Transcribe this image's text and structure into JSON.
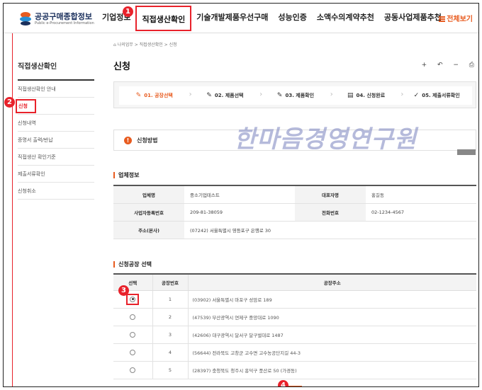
{
  "header": {
    "logo_title": "공공구매종합정보",
    "logo_sub": "Public e-Procurement Information",
    "nav": [
      "기업정보",
      "직접생산확인",
      "기술개발제품우선구매",
      "성능인증",
      "소액수의계약추천",
      "공동사업제품추천"
    ],
    "all_menu": "전체보기"
  },
  "sidebar": {
    "title": "직접생산확인",
    "items": [
      "직접생산확인 안내",
      "신청",
      "신청내역",
      "증명서 출력/반납",
      "직접생산 확인기준",
      "제출서류확인",
      "신청취소"
    ]
  },
  "main": {
    "breadcrumb": "나의업무 > 직접생산확인 > 신청",
    "title": "신청",
    "tools": "+ ↶ − ⎙",
    "steps": [
      {
        "label": "01. 공장선택",
        "icon": "✎"
      },
      {
        "label": "02. 제품선택",
        "icon": "✎"
      },
      {
        "label": "03. 제품확인",
        "icon": "✎"
      },
      {
        "label": "04. 신청완료",
        "icon": "▤"
      },
      {
        "label": "05. 제출서류확인",
        "icon": "✓"
      }
    ],
    "method": "신청방법",
    "watermark": "한마음경영연구원",
    "company_section": "업체정보",
    "company": {
      "name_label": "업체명",
      "name": "중소기업테스트",
      "ceo_label": "대표자명",
      "ceo": "홍길동",
      "bizno_label": "사업자등록번호",
      "bizno": "209-81-38059",
      "tel_label": "전화번호",
      "tel": "02-1234-4567",
      "addr_label": "주소(본사)",
      "addr": "(07242) 서울특별시 영등포구 은행로 30"
    },
    "factory_section": "신청공장 선택",
    "factory_headers": [
      "선택",
      "공장번호",
      "공장주소"
    ],
    "factories": [
      {
        "no": "1",
        "addr": "(03902) 서울특별시 마포구 성암로 189"
      },
      {
        "no": "2",
        "addr": "(47539) 부산광역시 연제구 중앙대로 1090"
      },
      {
        "no": "3",
        "addr": "(42606) 대구광역시 달서구 달구벌대로 1487"
      },
      {
        "no": "4",
        "addr": "(56644) 전라북도 고창군 고수면 고수농공단지길 44-3"
      },
      {
        "no": "5",
        "addr": "(28397) 충청북도 청주시 흥덕구 풍산로 50 (가경동)"
      }
    ]
  },
  "badges": [
    "1",
    "2",
    "3",
    "4"
  ],
  "colors": {
    "accent": "#e85b1f",
    "highlight": "#e8222b"
  }
}
